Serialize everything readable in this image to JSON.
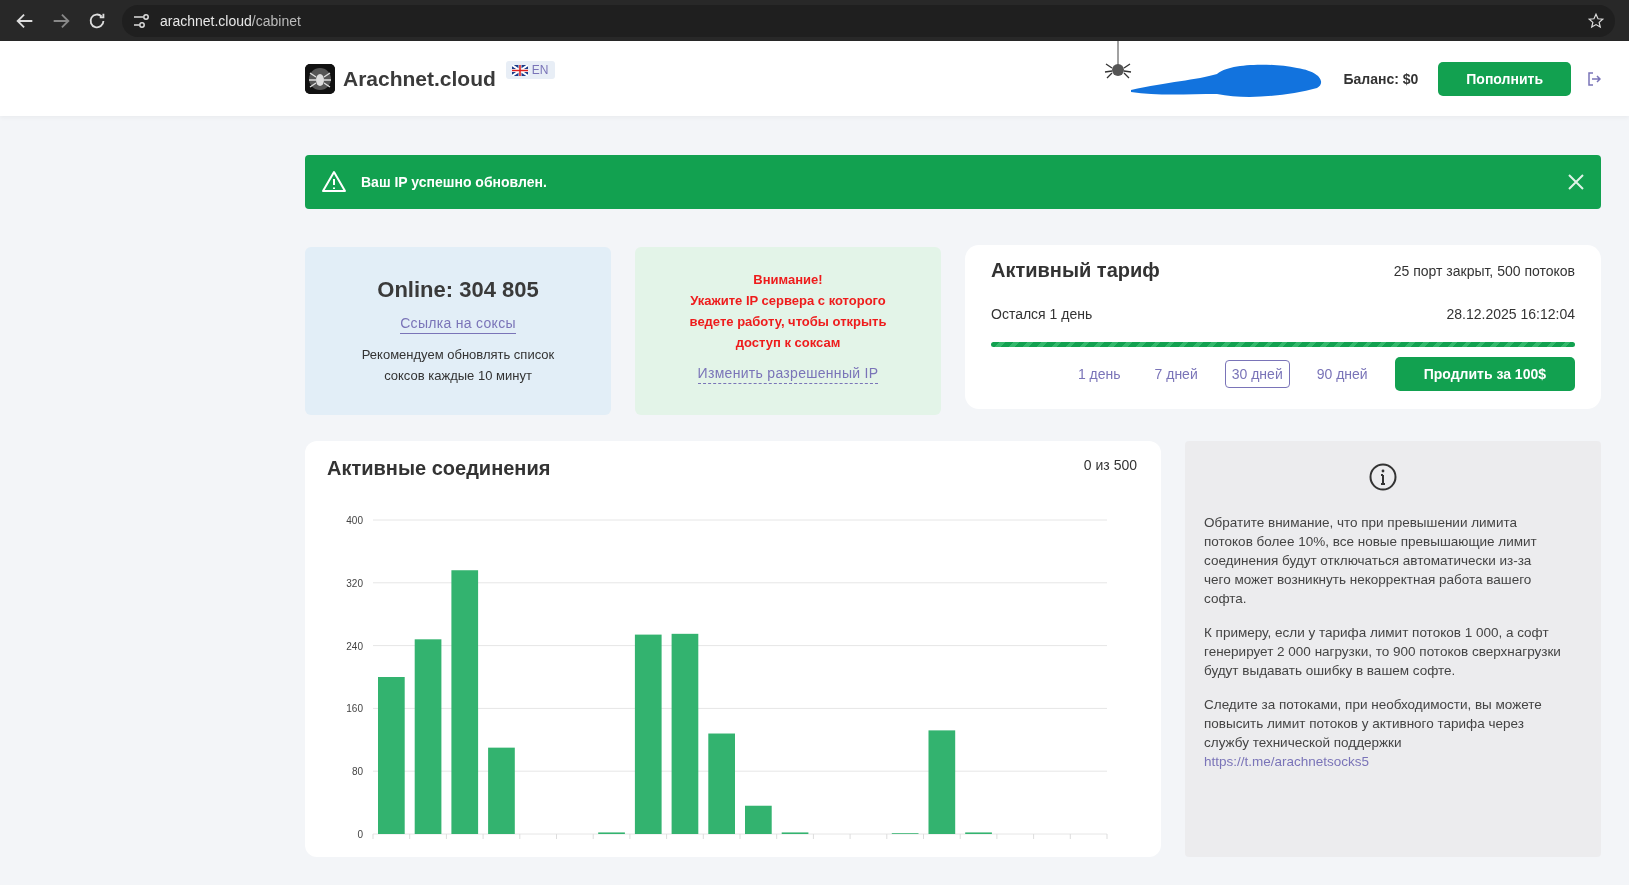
{
  "browser": {
    "url_host": "arachnet.cloud",
    "url_path": "/cabinet"
  },
  "header": {
    "brand": "Arachnet.cloud",
    "language": "EN",
    "balance": "Баланс: $0",
    "topup_button": "Пополнить"
  },
  "alert": {
    "text": "Ваш IP успешно обновлен."
  },
  "online_card": {
    "title": "Online: 304 805",
    "link": "Ссылка на соксы",
    "note": "Рекомендуем обновлять список соксов каждые 10 минут"
  },
  "warning_card": {
    "heading": "Внимание!",
    "text": "Укажите IP сервера с которого ведете работу, чтобы открыть доступ к соксам",
    "link": "Изменить разрешенный IP"
  },
  "tariff": {
    "title": "Активный тариф",
    "plan": "25 порт закрыт, 500 потоков",
    "remaining": "Остался 1 день",
    "expires": "28.12.2025 16:12:04",
    "level": 1,
    "periods": [
      {
        "label": "1 день",
        "selected": false
      },
      {
        "label": "7 дней",
        "selected": false
      },
      {
        "label": "30 дней",
        "selected": true
      },
      {
        "label": "90 дней",
        "selected": false
      }
    ],
    "renew_button": "Продлить за 100$"
  },
  "connections": {
    "title": "Активные соединения",
    "count": "0 из 500",
    "chart_data": {
      "type": "bar",
      "grid": true,
      "ylim": [
        0,
        400
      ],
      "yticks": [
        0,
        80,
        160,
        240,
        320,
        400
      ],
      "values": [
        200,
        248,
        336,
        110,
        0,
        0,
        2,
        254,
        255,
        128,
        36,
        2,
        0,
        0,
        1,
        132,
        2,
        0,
        0,
        0
      ]
    }
  },
  "info": {
    "paragraphs": [
      "Обратите внимание, что при превышении лимита потоков более 10%, все новые превышающие лимит соединения будут отключаться автоматически из-за чего может возникнуть некорректная работа вашего софта.",
      "К примеру, если у тарифа лимит потоков 1 000, а софт генерирует 2 000 нагрузки, то 900 потоков сверхнагрузки будут выдавать ошибку в вашем софте.",
      "Следите за потоками, при необходимости, вы можете повысить лимит потоков у активного тарифа через службу технической поддержки"
    ],
    "link": "https://t.me/arachnetsocks5"
  }
}
